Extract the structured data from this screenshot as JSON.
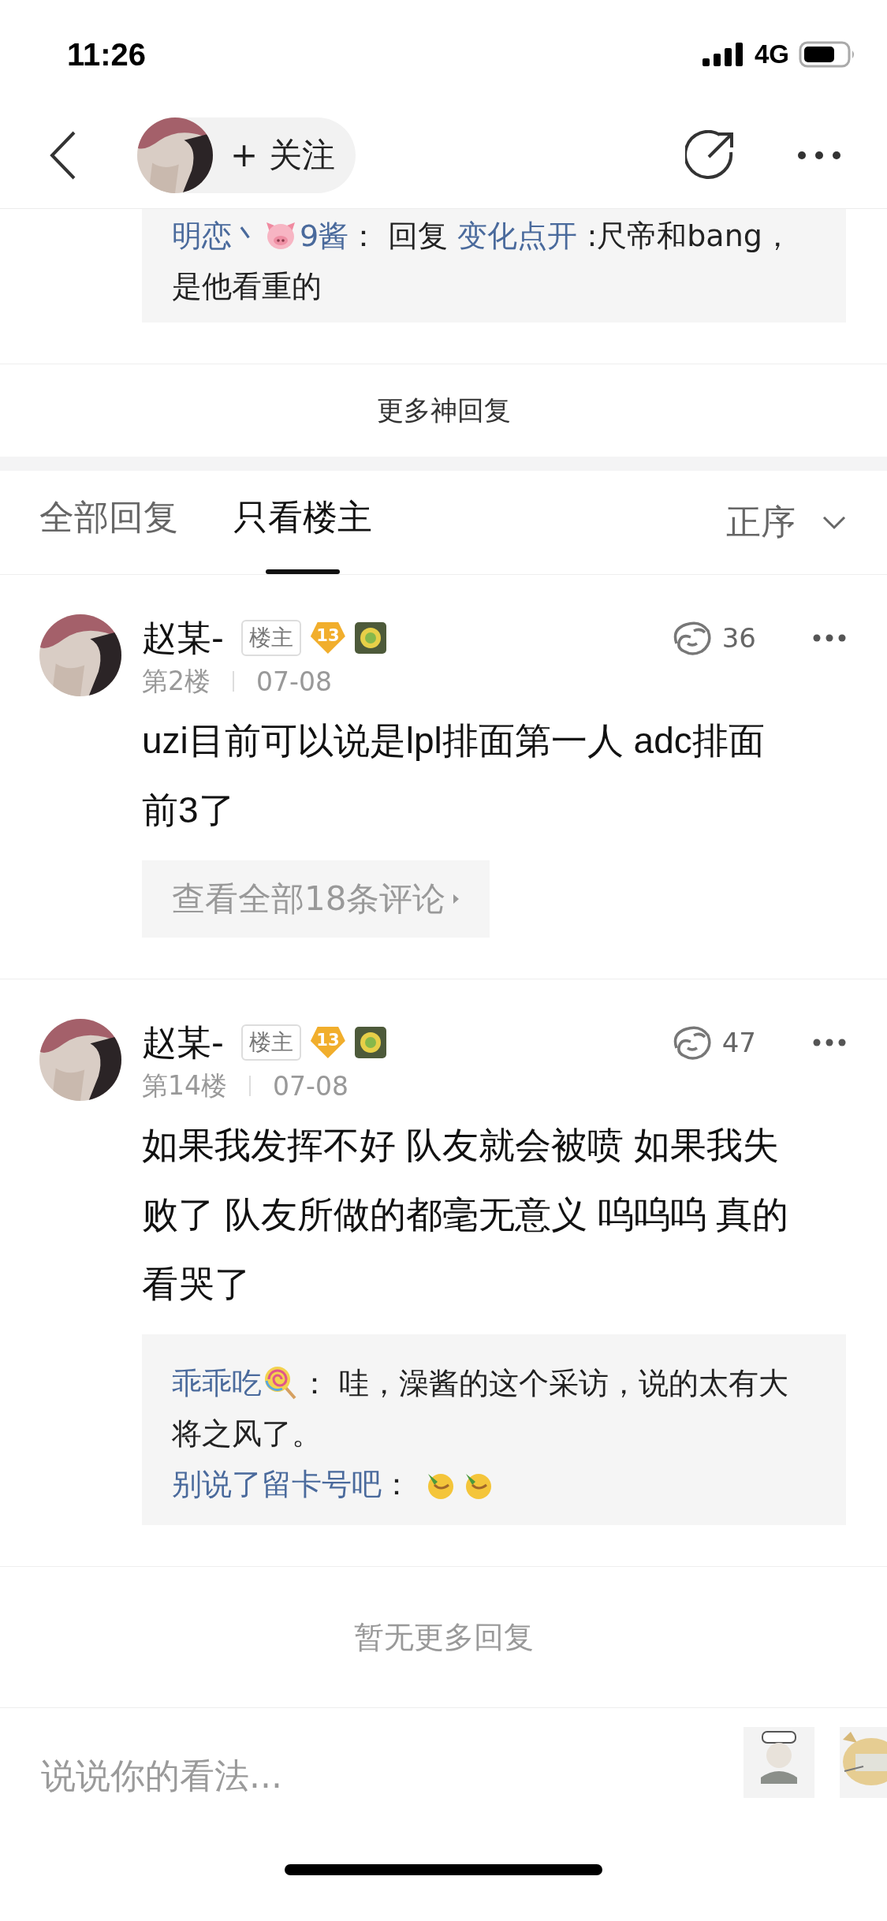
{
  "status_bar": {
    "time": "11:26",
    "network": "4G"
  },
  "nav": {
    "follow": "+ 关注"
  },
  "top_reply": {
    "segments": [
      {
        "kind": "link",
        "text": "明恋丶"
      },
      {
        "kind": "pig"
      },
      {
        "kind": "link",
        "text": "9酱"
      },
      {
        "kind": "text",
        "text": "： 回复 "
      },
      {
        "kind": "link",
        "text": "变化点开"
      },
      {
        "kind": "text",
        "text": " :尺帝和bang，是他看重的"
      }
    ]
  },
  "more_hot": "更多神回复",
  "tabs": [
    {
      "label": "全部回复",
      "selected": false
    },
    {
      "label": "只看楼主",
      "selected": true
    }
  ],
  "sort": {
    "label": "正序"
  },
  "comments": [
    {
      "author": "赵某-",
      "badge": "楼主",
      "level": "13",
      "likes": "36",
      "floor": "第2楼",
      "date": "07-08",
      "body": "uzi目前可以说是lpl排面第一人 adc排面前3了",
      "more": "查看全部18条评论"
    },
    {
      "author": "赵某-",
      "badge": "楼主",
      "level": "13",
      "likes": "47",
      "floor": "第14楼",
      "date": "07-08",
      "body": "如果我发挥不好 队友就会被喷 如果我失败了 队友所做的都毫无意义 呜呜呜 真的看哭了",
      "replies": [
        {
          "segments": [
            {
              "kind": "link",
              "text": "乖乖吃"
            },
            {
              "kind": "lollipop"
            },
            {
              "kind": "text",
              "text": "： 哇，澡酱的这个采访，说的太有大将之风了。"
            }
          ]
        },
        {
          "segments": [
            {
              "kind": "link",
              "text": "别说了留卡号吧"
            },
            {
              "kind": "text",
              "text": "： "
            },
            {
              "kind": "cheer"
            },
            {
              "kind": "cheer"
            }
          ]
        }
      ]
    }
  ],
  "end_note": "暂无更多回复",
  "composer": {
    "placeholder": "说说你的看法..."
  }
}
